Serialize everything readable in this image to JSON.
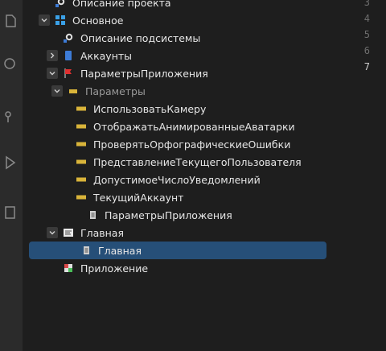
{
  "tree": {
    "rows": [
      {
        "label": "Описание проекта",
        "depth": 1,
        "chevron": "none",
        "icon": "gear-icon"
      },
      {
        "label": "Основное",
        "depth": 1,
        "chevron": "down",
        "icon": "subsystem-icon"
      },
      {
        "label": "Описание подсистемы",
        "depth": 2,
        "chevron": "none",
        "icon": "gear-icon"
      },
      {
        "label": "Аккаунты",
        "depth": 2,
        "chevron": "right",
        "icon": "catalog-icon"
      },
      {
        "label": "ПараметрыПриложения",
        "depth": 2,
        "chevron": "down",
        "icon": "flag-icon"
      },
      {
        "label": "Параметры",
        "depth": 3,
        "chevron": "down",
        "icon": "folder-icon",
        "muted": true
      },
      {
        "label": "ИспользоватьКамеру",
        "depth": 4,
        "chevron": "none",
        "icon": "parameter-icon"
      },
      {
        "label": "ОтображатьАнимированныеАватарки",
        "depth": 4,
        "chevron": "none",
        "icon": "parameter-icon"
      },
      {
        "label": "ПроверятьОрфографическиеОшибки",
        "depth": 4,
        "chevron": "none",
        "icon": "parameter-icon"
      },
      {
        "label": "ПредставлениеТекущегоПользователя",
        "depth": 4,
        "chevron": "none",
        "icon": "parameter-icon"
      },
      {
        "label": "ДопустимоеЧислоУведомлений",
        "depth": 4,
        "chevron": "none",
        "icon": "parameter-icon"
      },
      {
        "label": "ТекущийАккаунт",
        "depth": 4,
        "chevron": "none",
        "icon": "parameter-icon"
      },
      {
        "label": "ПараметрыПриложения",
        "depth": 3,
        "chevron": "none",
        "icon": "document-icon"
      },
      {
        "label": "Главная",
        "depth": 2,
        "chevron": "down",
        "icon": "form-icon"
      },
      {
        "label": "Главная",
        "depth": 3,
        "chevron": "none",
        "icon": "document-icon",
        "selected": true
      },
      {
        "label": "Приложение",
        "depth": 2,
        "chevron": "none",
        "icon": "app-icon"
      }
    ]
  },
  "editor": {
    "line_numbers": [
      "3",
      "4",
      "5",
      "6",
      "7"
    ],
    "current_line": "7"
  },
  "colors": {
    "selection": "#264f78",
    "parameter_icon": "#d9b43a",
    "flag": "#e03030"
  }
}
